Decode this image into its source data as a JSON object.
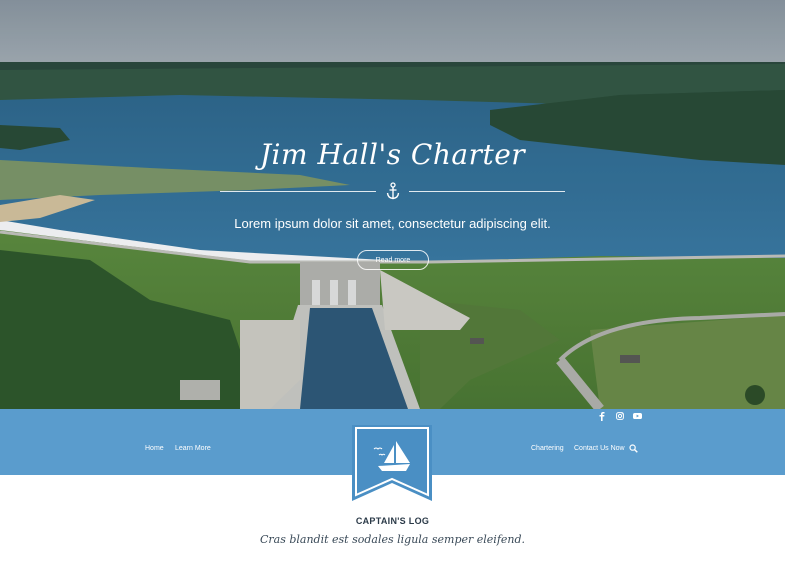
{
  "hero": {
    "title": "Jim Hall's Charter",
    "subtitle": "Lorem ipsum dolor sit amet, consectetur adipiscing elit.",
    "button_label": "Read more"
  },
  "social": [
    "facebook-icon",
    "instagram-icon",
    "youtube-icon"
  ],
  "nav": {
    "left": [
      "Home",
      "Learn More"
    ],
    "right": [
      "Chartering",
      "Contact Us Now"
    ]
  },
  "section": {
    "title": "CAPTAIN'S LOG",
    "subtitle": "Cras blandit est sodales ligula semper eleifend."
  },
  "colors": {
    "accent": "#5a9ccd",
    "badge": "#4a8fc4",
    "text_dark": "#2b3a48"
  }
}
